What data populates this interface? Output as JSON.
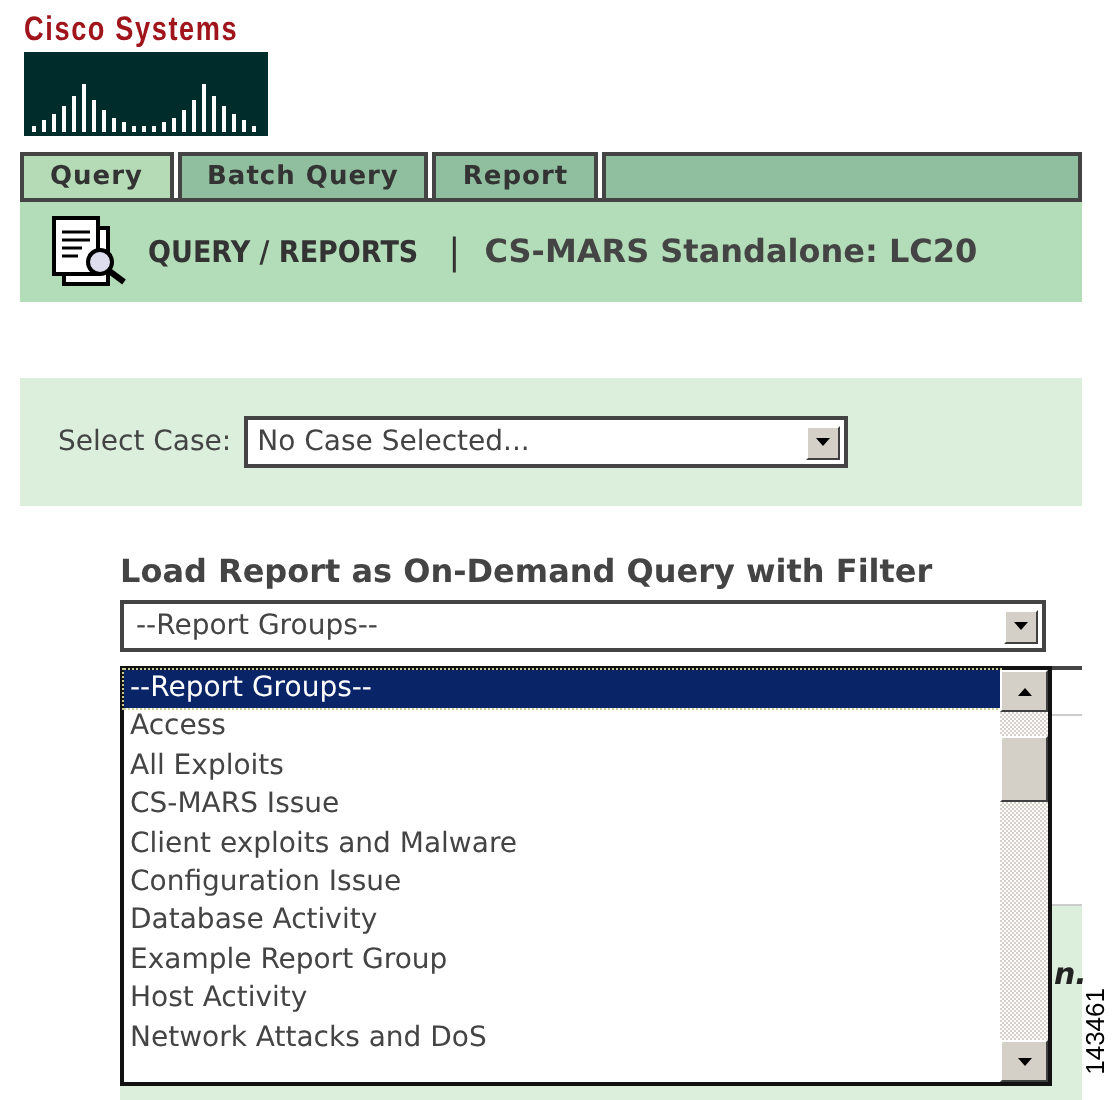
{
  "logo": {
    "wordmark": "Cisco Systems"
  },
  "tabs": [
    {
      "label": "Query",
      "selected": true
    },
    {
      "label": "Batch Query",
      "selected": false
    },
    {
      "label": "Report",
      "selected": false
    }
  ],
  "header": {
    "title": "QUERY / REPORTS",
    "separator": "|",
    "subtitle": "CS-MARS Standalone: LC20"
  },
  "case_select": {
    "label": "Select Case:",
    "value": "No Case Selected..."
  },
  "report_section": {
    "heading": "Load Report as On-Demand Query with Filter",
    "dropdown": {
      "value": "--Report Groups--",
      "expanded": true,
      "options": [
        {
          "label": "--Report Groups--",
          "selected": true
        },
        {
          "label": "Access",
          "selected": false
        },
        {
          "label": "All Exploits",
          "selected": false
        },
        {
          "label": "CS-MARS Issue",
          "selected": false
        },
        {
          "label": "Client exploits and Malware",
          "selected": false
        },
        {
          "label": "Configuration Issue",
          "selected": false
        },
        {
          "label": "Database Activity",
          "selected": false
        },
        {
          "label": "Example Report Group",
          "selected": false
        },
        {
          "label": "Host Activity",
          "selected": false
        },
        {
          "label": "Network Attacks and DoS",
          "selected": false
        }
      ]
    }
  },
  "background_fragment": "n.",
  "figure_number": "143461"
}
